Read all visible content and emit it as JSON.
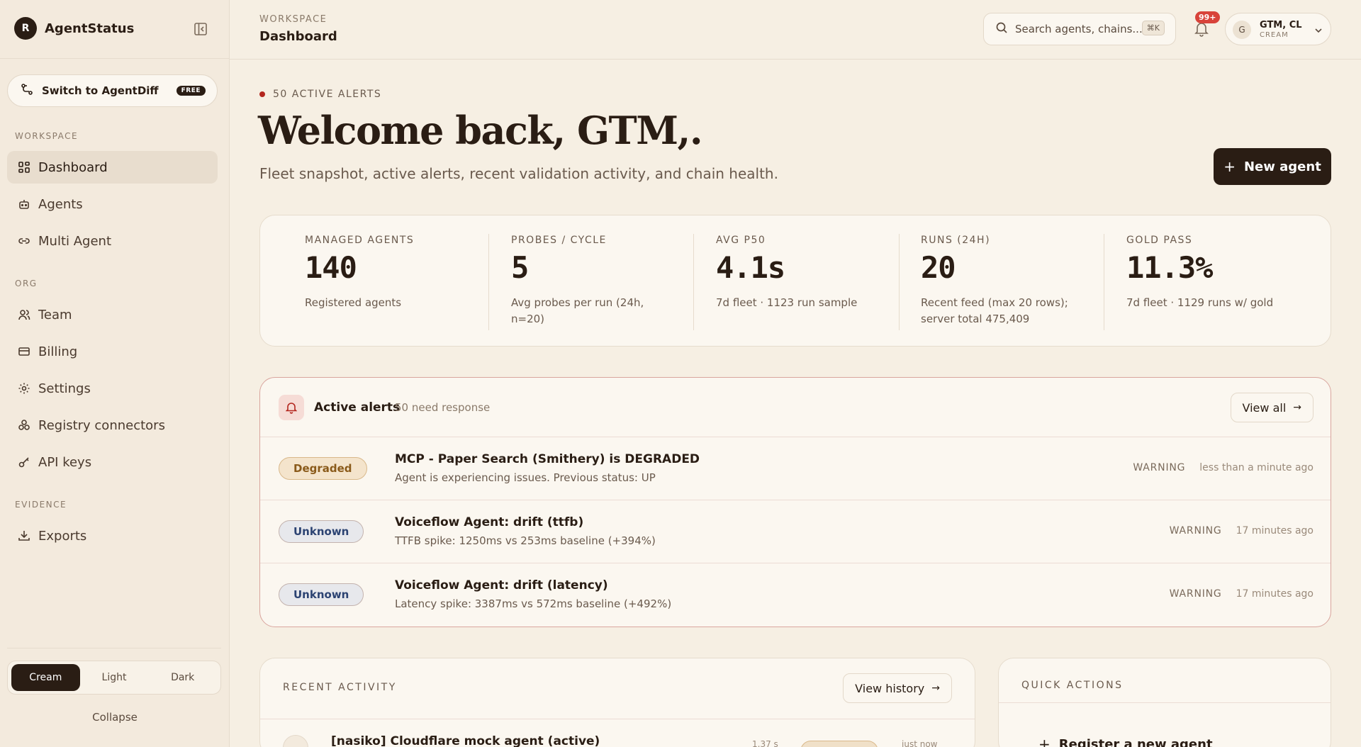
{
  "brand": {
    "logo_letter": "R",
    "name": "AgentStatus"
  },
  "sidebar": {
    "switch": {
      "label": "Switch to AgentDiff",
      "badge": "FREE"
    },
    "sections": {
      "workspace": "WORKSPACE",
      "org": "ORG",
      "evidence": "EVIDENCE"
    },
    "items": {
      "dashboard": "Dashboard",
      "agents": "Agents",
      "multi_agent": "Multi Agent",
      "team": "Team",
      "billing": "Billing",
      "settings": "Settings",
      "registry": "Registry connectors",
      "api_keys": "API keys",
      "exports": "Exports"
    },
    "active_item": "Dashboard",
    "theme": {
      "options": [
        "Cream",
        "Light",
        "Dark"
      ],
      "selected": "Cream"
    },
    "collapse_label": "Collapse"
  },
  "header": {
    "breadcrumb_section": "WORKSPACE",
    "breadcrumb_page": "Dashboard",
    "search_placeholder": "Search agents, chains...",
    "search_shortcut": "⌘K",
    "notifications_badge": "99+",
    "user": {
      "avatar_letter": "G",
      "name": "GTM, CL",
      "theme": "CREAM"
    }
  },
  "hero": {
    "kicker": "50 ACTIVE ALERTS",
    "title": "Welcome back, GTM,.",
    "subtitle": "Fleet snapshot, active alerts, recent validation activity, and chain health.",
    "new_agent_label": "New agent"
  },
  "stats": [
    {
      "label": "MANAGED AGENTS",
      "value": "140",
      "desc": "Registered agents"
    },
    {
      "label": "PROBES / CYCLE",
      "value": "5",
      "desc": "Avg probes per run (24h, n=20)"
    },
    {
      "label": "AVG P50",
      "value": "4.1s",
      "desc": "7d fleet · 1123 run sample"
    },
    {
      "label": "RUNS (24H)",
      "value": "20",
      "desc": "Recent feed (max 20 rows); server total 475,409"
    },
    {
      "label": "GOLD PASS",
      "value": "11.3%",
      "desc": "7d fleet · 1129 runs w/ gold"
    }
  ],
  "alerts": {
    "title": "Active alerts",
    "subtitle": "50 need response",
    "view_all_label": "View all",
    "rows": [
      {
        "status": "Degraded",
        "title": "MCP - Paper Search (Smithery) is DEGRADED",
        "desc": "Agent is experiencing issues. Previous status: UP",
        "severity": "WARNING",
        "time": "less than a minute ago"
      },
      {
        "status": "Unknown",
        "title": "Voiceflow Agent: drift (ttfb)",
        "desc": "TTFB spike: 1250ms vs 253ms baseline (+394%)",
        "severity": "WARNING",
        "time": "17 minutes ago"
      },
      {
        "status": "Unknown",
        "title": "Voiceflow Agent: drift (latency)",
        "desc": "Latency spike: 3387ms vs 572ms baseline (+492%)",
        "severity": "WARNING",
        "time": "17 minutes ago"
      }
    ]
  },
  "recent": {
    "label": "RECENT ACTIVITY",
    "view_history_label": "View history",
    "first_row_title": "[nasiko] Cloudflare mock agent (active)",
    "first_row_extra1": "1.37 s",
    "first_row_extra2": "just now"
  },
  "quick_actions": {
    "label": "QUICK ACTIONS",
    "first_item": "Register a new agent"
  }
}
